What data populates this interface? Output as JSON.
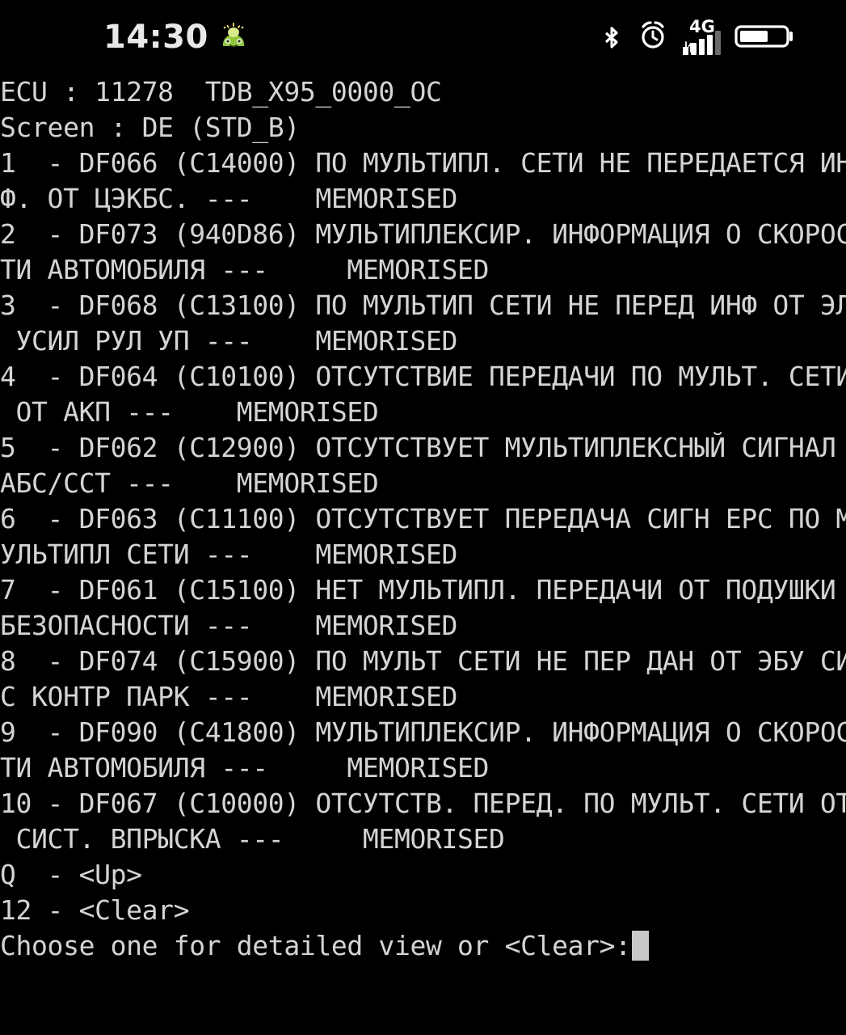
{
  "status_bar": {
    "time": "14:30",
    "emoji_icon": "green-creature-icon",
    "icons": [
      "bluetooth-icon",
      "alarm-clock-icon",
      "network-signal-icon",
      "battery-icon"
    ],
    "network_label": "4G",
    "signal_bars_total": 5,
    "signal_bars_filled": 4,
    "battery_level_percent": 60,
    "colors": {
      "background": "#000000",
      "foreground": "#ffffff",
      "emoji_green": "#8fc63d"
    }
  },
  "terminal": {
    "colors": {
      "background": "#000000",
      "text": "#d4d4d4",
      "cursor": "#c9c9c9"
    },
    "header": {
      "ecu_line": "ECU : 11278  TDB_X95_0000_OC",
      "screen_line": "Screen : DE (STD_B)"
    },
    "lines": [
      "ECU : 11278  TDB_X95_0000_OC",
      "Screen : DE (STD_B)",
      "1  - DF066 (C14000) ПО МУЛЬТИПЛ. СЕТИ НЕ ПЕРЕДАЕТСЯ ИНФ",
      "Ф. ОТ ЦЭКБС. ---    MEMORISED",
      "2  - DF073 (940D86) МУЛЬТИПЛЕКСИР. ИНФОРМАЦИЯ О СКОРОСТ",
      "ТИ АВТОМОБИЛЯ ---     MEMORISED",
      "3  - DF068 (C13100) ПО МУЛЬТИП СЕТИ НЕ ПЕРЕД ИНФ ОТ ЭЛ",
      " УСИЛ РУЛ УП ---    MEMORISED",
      "4  - DF064 (C10100) ОТСУТСТВИЕ ПЕРЕДАЧИ ПО МУЛЬТ. СЕТИ",
      " ОТ АКП ---    MEMORISED",
      "5  - DF062 (C12900) ОТСУТСТВУЕТ МУЛЬТИПЛЕКСНЫЙ СИГНАЛ",
      "АБС/ССТ ---    MEMORISED",
      "6  - DF063 (C11100) ОТСУТСТВУЕТ ПЕРЕДАЧА СИГН ЕРС ПО М",
      "УЛЬТИПЛ СЕТИ ---    MEMORISED",
      "7  - DF061 (C15100) НЕТ МУЛЬТИПЛ. ПЕРЕДАЧИ ОТ ПОДУШКИ",
      "БЕЗОПАСНОСТИ ---    MEMORISED",
      "8  - DF074 (C15900) ПО МУЛЬТ СЕТИ НЕ ПЕР ДАН ОТ ЭБУ СИ",
      "С КОНТР ПАРК ---    MEMORISED",
      "9  - DF090 (C41800) МУЛЬТИПЛЕКСИР. ИНФОРМАЦИЯ О СКОРОСТ",
      "ТИ АВТОМОБИЛЯ ---     MEMORISED",
      "10 - DF067 (C10000) ОТСУТСТВ. ПЕРЕД. ПО МУЛЬТ. СЕТИ ОТ",
      " СИСТ. ВПРЫСКА ---     MEMORISED",
      "Q  - <Up>",
      "12 - <Clear>"
    ],
    "fault_entries": [
      {
        "index": "1",
        "code": "DF066",
        "hex": "C14000",
        "description": "ПО МУЛЬТИПЛ. СЕТИ НЕ ПЕРЕДАЕТСЯ ИНФФ. ОТ ЦЭКБС.",
        "status": "MEMORISED"
      },
      {
        "index": "2",
        "code": "DF073",
        "hex": "940D86",
        "description": "МУЛЬТИПЛЕКСИР. ИНФОРМАЦИЯ О СКОРОСТИ АВТОМОБИЛЯ",
        "status": "MEMORISED"
      },
      {
        "index": "3",
        "code": "DF068",
        "hex": "C13100",
        "description": "ПО МУЛЬТИП СЕТИ НЕ ПЕРЕД ИНФ ОТ ЭЛ УСИЛ РУЛ УП",
        "status": "MEMORISED"
      },
      {
        "index": "4",
        "code": "DF064",
        "hex": "C10100",
        "description": "ОТСУТСТВИЕ ПЕРЕДАЧИ ПО МУЛЬТ. СЕТИ ОТ АКП",
        "status": "MEMORISED"
      },
      {
        "index": "5",
        "code": "DF062",
        "hex": "C12900",
        "description": "ОТСУТСТВУЕТ МУЛЬТИПЛЕКСНЫЙ СИГНАЛ АБС/ССТ",
        "status": "MEMORISED"
      },
      {
        "index": "6",
        "code": "DF063",
        "hex": "C11100",
        "description": "ОТСУТСТВУЕТ ПЕРЕДАЧА СИГН ЕРС ПО МУЛЬТИПЛ СЕТИ",
        "status": "MEMORISED"
      },
      {
        "index": "7",
        "code": "DF061",
        "hex": "C15100",
        "description": "НЕТ МУЛЬТИПЛ. ПЕРЕДАЧИ ОТ ПОДУШКИ БЕЗОПАСНОСТИ",
        "status": "MEMORISED"
      },
      {
        "index": "8",
        "code": "DF074",
        "hex": "C15900",
        "description": "ПО МУЛЬТ СЕТИ НЕ ПЕР ДАН ОТ ЭБУ СИС КОНТР ПАРК",
        "status": "MEMORISED"
      },
      {
        "index": "9",
        "code": "DF090",
        "hex": "C41800",
        "description": "МУЛЬТИПЛЕКСИР. ИНФОРМАЦИЯ О СКОРОСТИ АВТОМОБИЛЯ",
        "status": "MEMORISED"
      },
      {
        "index": "10",
        "code": "DF067",
        "hex": "C10000",
        "description": "ОТСУТСТВ. ПЕРЕД. ПО МУЛЬТ. СЕТИ ОТ СИСТ. ВПРЫСКА",
        "status": "MEMORISED"
      }
    ],
    "menu_options": [
      {
        "key": "Q",
        "label": "<Up>"
      },
      {
        "key": "12",
        "label": "<Clear>"
      }
    ],
    "prompt": "Choose one for detailed view or <Clear>:"
  }
}
